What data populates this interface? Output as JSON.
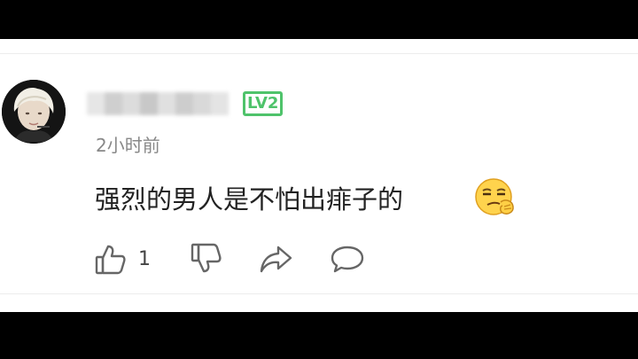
{
  "comment": {
    "level_badge": "LV2",
    "timestamp": "2小时前",
    "text": "强烈的男人是不怕出痱子的",
    "emoji": "smirk-face-emoji",
    "like_count": "1"
  },
  "icons": {
    "like": "thumbs-up-icon",
    "dislike": "thumbs-down-icon",
    "share": "share-arrow-icon",
    "reply": "speech-bubble-icon"
  },
  "colors": {
    "level_badge": "#4fc36b",
    "timestamp": "#888888",
    "comment_text": "#222222",
    "icon_stroke": "#666666",
    "letterbox": "#000000",
    "panel": "#ffffff"
  }
}
